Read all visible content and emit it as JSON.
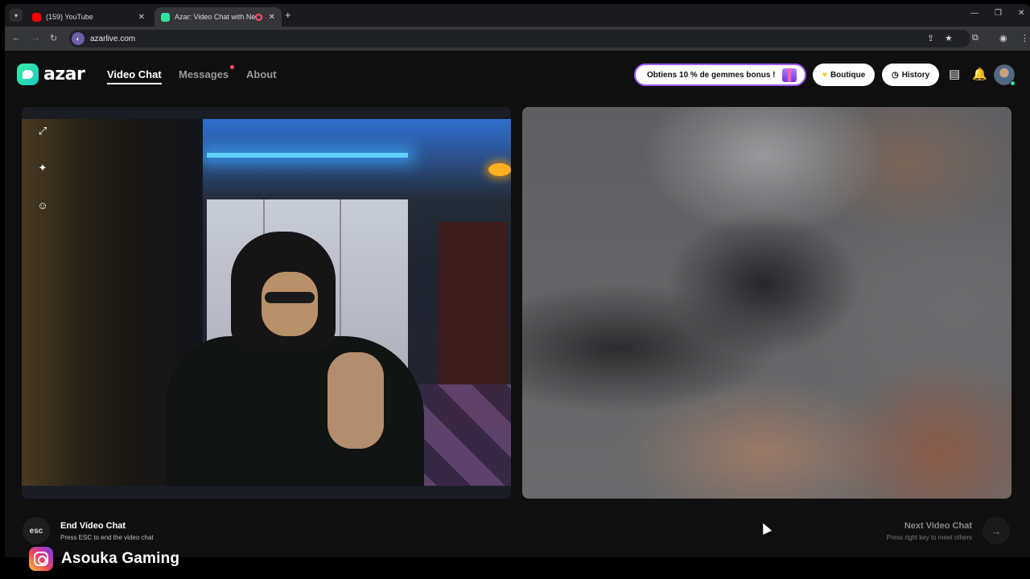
{
  "browser": {
    "tabs": [
      {
        "title": "(159) YouTube",
        "favicon": "youtube-icon",
        "active": false
      },
      {
        "title": "Azar: Video Chat with New",
        "favicon": "azar-icon",
        "active": true,
        "recording": true
      }
    ],
    "url": "azarlive.com"
  },
  "app": {
    "logo_text": "azar",
    "nav": [
      {
        "label": "Video Chat",
        "active": true
      },
      {
        "label": "Messages",
        "active": false,
        "has_dot": true
      },
      {
        "label": "About",
        "active": false
      }
    ],
    "promo_label": "Obtiens 10 % de gemmes bonus !",
    "shop_label": "Boutique",
    "history_label": "History",
    "colors": {
      "accent": "#2ee59d",
      "notification_dot": "#ff4d6d",
      "promo_border": "#9b5cff"
    }
  },
  "footer": {
    "esc_key": "esc",
    "end_title": "End Video Chat",
    "end_sub": "Press ESC to end the video chat",
    "next_title": "Next Video Chat",
    "next_sub": "Press right key to meet others"
  },
  "overlay": {
    "handle": "Asouka Gaming"
  }
}
